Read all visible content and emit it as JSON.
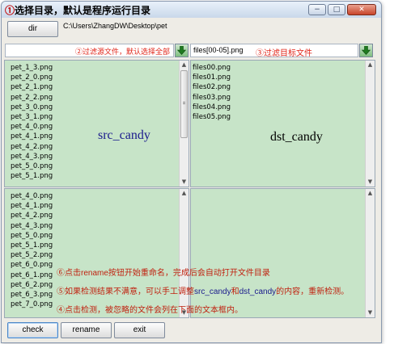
{
  "window": {
    "title_marker": "①",
    "title_text": "选择目录，默认是程序运行目录",
    "controls": {
      "minimize": "−",
      "maximize": "□",
      "close": "✕"
    }
  },
  "toolbar": {
    "dir_label": "dir",
    "path": "C:\\Users\\ZhangDW\\Desktop\\pet"
  },
  "src_filter": {
    "placeholder": "②过滤源文件，默认选择全部"
  },
  "dst_filter": {
    "value": "files[00-05].png",
    "label": "③过滤目标文件"
  },
  "src_list": {
    "tag": "src_candy",
    "items": [
      "pet_1_3.png",
      "pet_2_0.png",
      "pet_2_1.png",
      "pet_2_2.png",
      "pet_3_0.png",
      "pet_3_1.png",
      "pet_4_0.png",
      "pet_4_1.png",
      "pet_4_2.png",
      "pet_4_3.png",
      "pet_5_0.png",
      "pet_5_1.png"
    ]
  },
  "dst_list": {
    "tag": "dst_candy",
    "items": [
      "files00.png",
      "files01.png",
      "files02.png",
      "files03.png",
      "files04.png",
      "files05.png"
    ]
  },
  "ignored_list": {
    "items": [
      "pet_4_0.png",
      "pet_4_1.png",
      "pet_4_2.png",
      "pet_4_3.png",
      "pet_5_0.png",
      "pet_5_1.png",
      "pet_5_2.png",
      "pet_6_0.png",
      "pet_6_1.png",
      "pet_6_2.png",
      "pet_6_3.png",
      "pet_7_0.png"
    ]
  },
  "notes": {
    "step6": "⑥点击rename按钮开始重命名，完成后会自动打开文件目录",
    "step5_a": "⑤如果检测结果不满意，可以手工调整",
    "step5_src": "src_candy",
    "step5_mid": "和",
    "step5_dst": "dst_candy",
    "step5_b": "的内容，重新检测。",
    "step4": "④点击检测，被忽略的文件会列在下面的文本框内。"
  },
  "buttons": {
    "check": "check",
    "rename": "rename",
    "exit": "exit"
  },
  "colors": {
    "list_bg": "#c7e4c8",
    "note_red": "#c0210f",
    "label_red": "#e0261a",
    "accent_blue": "#1a1a8c"
  }
}
